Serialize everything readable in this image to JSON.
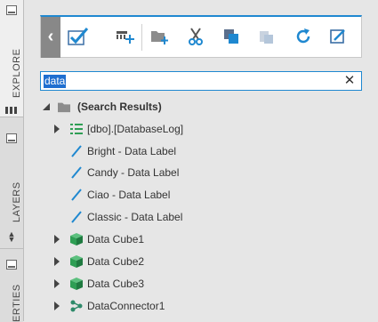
{
  "side_tabs": {
    "explore": "EXPLORE",
    "layers": "LAYERS",
    "properties": "ERTIES"
  },
  "toolbar": {
    "icons": [
      "back-chevron",
      "select-all-checkbox",
      "add-column",
      "add-folder",
      "cut",
      "copy",
      "paste",
      "refresh",
      "edit"
    ]
  },
  "search": {
    "value": "data"
  },
  "tree": {
    "root_label": "(Search Results)",
    "items": [
      {
        "label": "[dbo].[DatabaseLog]",
        "icon": "table-icon",
        "expandable": true
      },
      {
        "label": "Bright - Data Label",
        "icon": "data-label-icon",
        "expandable": false
      },
      {
        "label": "Candy - Data Label",
        "icon": "data-label-icon",
        "expandable": false
      },
      {
        "label": "Ciao - Data Label",
        "icon": "data-label-icon",
        "expandable": false
      },
      {
        "label": "Classic - Data Label",
        "icon": "data-label-icon",
        "expandable": false
      },
      {
        "label": "Data Cube1",
        "icon": "cube-icon",
        "expandable": true
      },
      {
        "label": "Data Cube2",
        "icon": "cube-icon",
        "expandable": true
      },
      {
        "label": "Data Cube3",
        "icon": "cube-icon",
        "expandable": true
      },
      {
        "label": "DataConnector1",
        "icon": "connector-icon",
        "expandable": true
      }
    ]
  },
  "colors": {
    "accent": "#1f88d0",
    "cube": "#2e9e54",
    "connector": "#2e8a6a",
    "label_pen": "#1f88d0"
  }
}
